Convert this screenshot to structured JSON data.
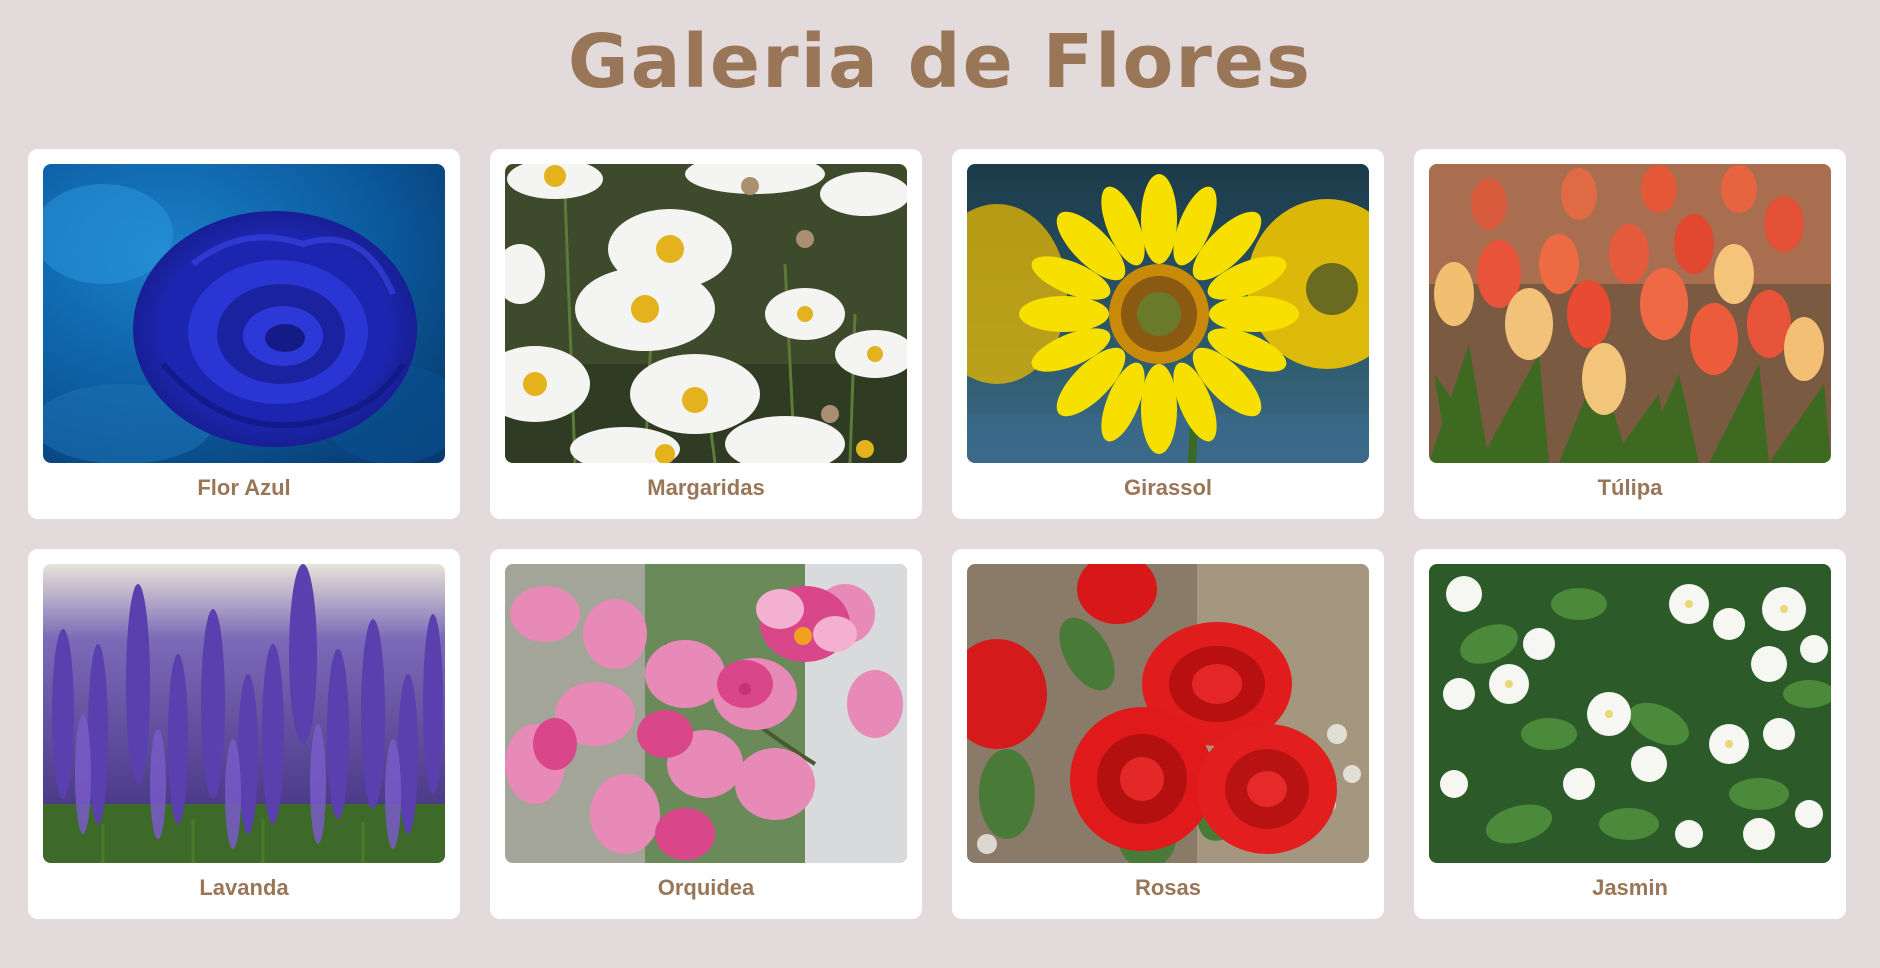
{
  "page": {
    "title": "Galeria de Flores"
  },
  "gallery": {
    "items": [
      {
        "caption": "Flor Azul",
        "icon": "blue-rose-photo"
      },
      {
        "caption": "Margaridas",
        "icon": "daisies-photo"
      },
      {
        "caption": "Girassol",
        "icon": "sunflower-photo"
      },
      {
        "caption": "Túlipa",
        "icon": "tulips-photo"
      },
      {
        "caption": "Lavanda",
        "icon": "lavender-photo"
      },
      {
        "caption": "Orquidea",
        "icon": "orchids-photo"
      },
      {
        "caption": "Rosas",
        "icon": "red-roses-photo"
      },
      {
        "caption": "Jasmin",
        "icon": "jasmine-photo"
      }
    ]
  },
  "colors": {
    "background": "#e3dadb",
    "card": "#ffffff",
    "accent": "#9a7658"
  }
}
